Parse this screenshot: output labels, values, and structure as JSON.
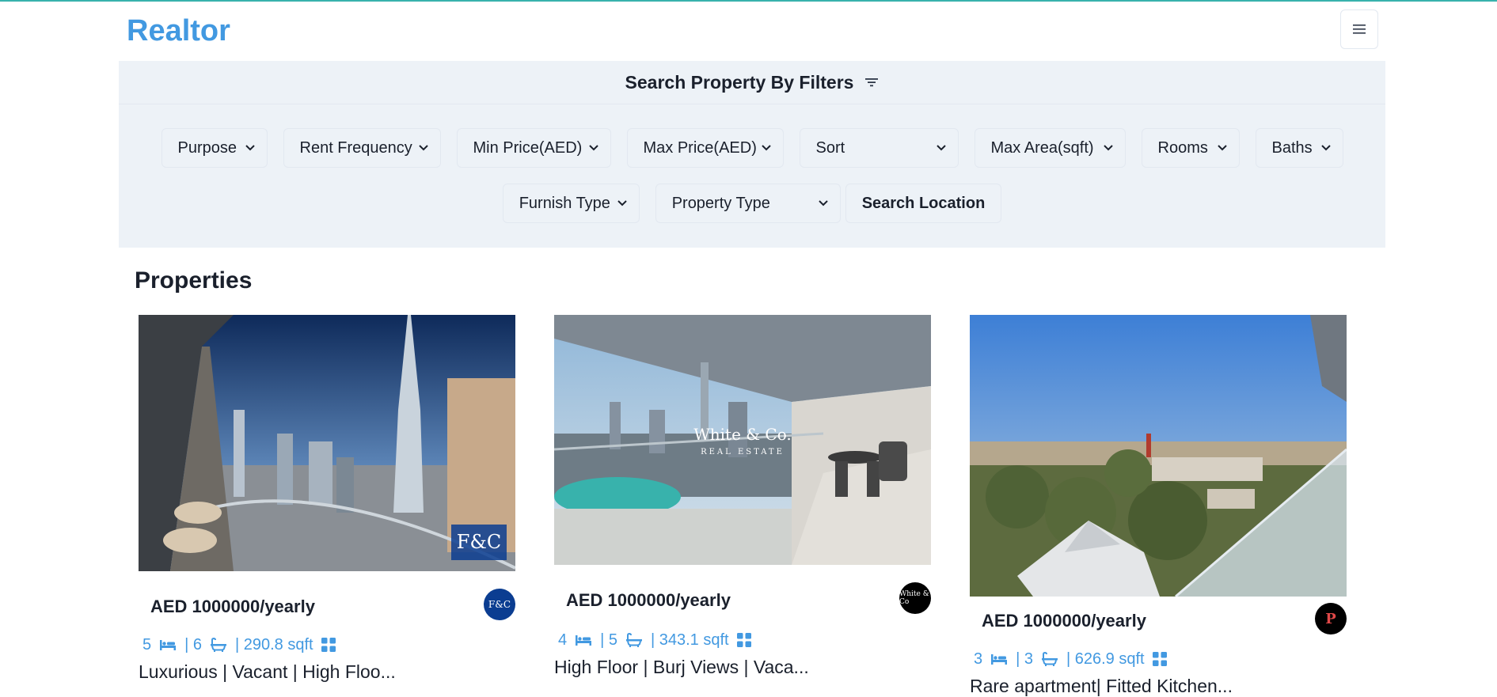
{
  "app": {
    "brand": "Realtor"
  },
  "filters": {
    "title": "Search Property By Filters",
    "row1": [
      "Purpose",
      "Rent Frequency",
      "Min Price(AED)",
      "Max Price(AED)",
      "Sort",
      "Max Area(sqft)",
      "Rooms",
      "Baths"
    ],
    "row2": [
      "Furnish Type",
      "Property Type"
    ],
    "search_location": "Search Location"
  },
  "properties": {
    "heading": "Properties",
    "items": [
      {
        "price": "AED 1000000/yearly",
        "rooms": "5",
        "baths": "| 6",
        "area": "| 290.8 sqft",
        "title": "Luxurious | Vacant | High Floo...",
        "agency_text": "F&C",
        "agency_color": "#0b3d91"
      },
      {
        "price": "AED 1000000/yearly",
        "rooms": "4",
        "baths": "| 5",
        "area": "| 343.1 sqft",
        "title": "High Floor | Burj Views | Vaca...",
        "agency_text": "White & Co",
        "agency_color": "#000000",
        "watermark": "White & Co.",
        "watermark_sub": "REAL ESTATE"
      },
      {
        "price": "AED 1000000/yearly",
        "rooms": "3",
        "baths": "| 3",
        "area": "| 626.9 sqft",
        "title": "Rare apartment| Fitted Kitchen...",
        "agency_text": "P",
        "agency_color": "#000000"
      }
    ]
  },
  "colors": {
    "accent": "#4299e1",
    "panel": "#edf2f7",
    "topbar": "#38b2ac"
  },
  "icons": {
    "menu": "hamburger-icon",
    "filter": "filter-icon",
    "bed": "bed-icon",
    "bath": "bath-icon",
    "area": "grid-icon",
    "chevron": "chevron-down-icon"
  }
}
